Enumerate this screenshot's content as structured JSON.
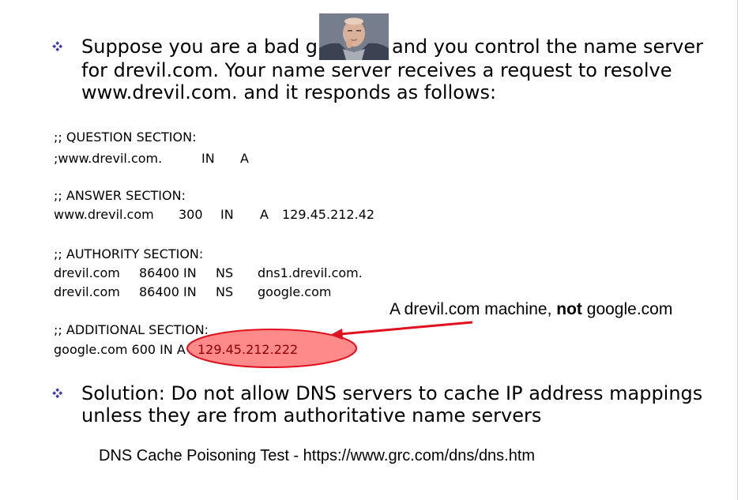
{
  "bullets": {
    "first": {
      "line1_before_photo": "Suppose you are a bad guy",
      "line1_after_photo": "and you control the name server",
      "line2": "for drevil.com. Your name server receives a request to resolve",
      "line3": "www.drevil.com. and it responds as follows:"
    },
    "second": {
      "line1": "Solution: Do not allow DNS servers to cache IP address mappings",
      "line2": "unless they are from authoritative name servers"
    }
  },
  "dns_response": {
    "question": {
      "header": ";; QUESTION SECTION:",
      "name": ";www.drevil.com.",
      "class": "IN",
      "type": "A"
    },
    "answer": {
      "header": ";; ANSWER SECTION:",
      "name": "www.drevil.com",
      "ttl": "300",
      "class": "IN",
      "type": "A",
      "address": "129.45.212.42"
    },
    "authority": {
      "header": ";; AUTHORITY SECTION:",
      "records": [
        {
          "name": "drevil.com",
          "ttl_class": "86400 IN",
          "type": "NS",
          "value": "dns1.drevil.com."
        },
        {
          "name": "drevil.com",
          "ttl_class": "86400 IN",
          "type": "NS",
          "value": "google.com"
        }
      ]
    },
    "additional": {
      "header": ";; ADDITIONAL SECTION:",
      "prefix": "google.com  600 IN A",
      "address": "129.45.212.222"
    }
  },
  "callout": {
    "before": "A drevil.com machine,",
    "bold": "not",
    "after": "google.com"
  },
  "footer": "DNS Cache Poisoning Test - https://www.grc.com/dns/dns.htm",
  "colors": {
    "bullet": "#3b3bb3",
    "highlight_fill": "#ff8a8a",
    "highlight_stroke": "#e0101f",
    "arrow": "#e0101f",
    "ip_text": "#8b0000"
  }
}
